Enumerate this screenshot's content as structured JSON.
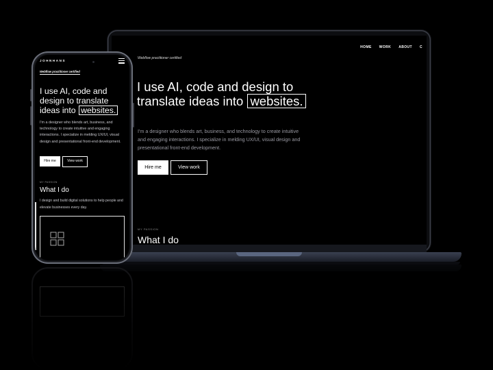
{
  "laptop": {
    "nav": [
      "HOME",
      "WORK",
      "ABOUT",
      "C"
    ],
    "certified": "Webflow practitioner certified",
    "headline_part1": "I use AI, code and design to translate ideas into",
    "headline_highlight": "websites.",
    "paragraph": "I'm a designer who blends art, business, and technology to create intuitive and engaging interactions. I specialize in melding UX/UI, visual design and presentational front-end development.",
    "hire_label": "Hire me",
    "view_label": "View work",
    "passion_label": "MY PASSION",
    "what_i_do": "What I do"
  },
  "phone": {
    "logo": "JOHNHANS",
    "certified": "Webflow practitioner certified",
    "headline_part1": "I use AI, code and design to translate ideas into",
    "headline_highlight": "websites.",
    "paragraph": "I'm a designer who blends art, business, and technology to create intuitive and engaging interactions. I specialize in melding UX/UI, visual design and presentational front-end development.",
    "hire_label": "Hire me",
    "view_label": "View work",
    "passion_label": "MY PASSION",
    "what_i_do": "What I do",
    "what_i_do_text": "I design and build digital solutions to help people and elevate businesses every day."
  },
  "colors": {
    "background": "#000000",
    "text": "#ffffff",
    "muted_text": "#9a9aa3",
    "device_frame": "#3a3d46"
  },
  "icons": {
    "phone_menu": "hamburger-menu-icon",
    "phone_card": "grid-layout-icon"
  }
}
